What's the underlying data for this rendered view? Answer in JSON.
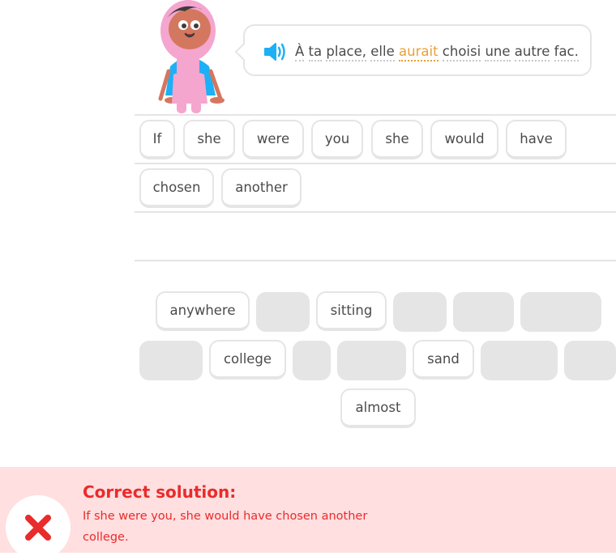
{
  "prompt": {
    "words": [
      {
        "text": "À",
        "highlight": false
      },
      {
        "text": "ta",
        "highlight": false
      },
      {
        "text": "place,",
        "highlight": false
      },
      {
        "text": "elle",
        "highlight": false
      },
      {
        "text": "aurait",
        "highlight": true
      },
      {
        "text": "choisi",
        "highlight": false
      },
      {
        "text": "une",
        "highlight": false
      },
      {
        "text": "autre",
        "highlight": false
      },
      {
        "text": "fac.",
        "highlight": false
      }
    ]
  },
  "answer_tiles": [
    "If",
    "she",
    "were",
    "you",
    "she",
    "would",
    "have",
    "chosen",
    "another"
  ],
  "word_bank": {
    "row1": [
      "anywhere",
      "",
      "sitting",
      "",
      "",
      ""
    ],
    "row2": [
      "",
      "college",
      "",
      "",
      "sand",
      "",
      ""
    ],
    "row3": [
      "almost"
    ]
  },
  "feedback": {
    "title": "Correct solution:",
    "solution": "If she were you, she would have chosen another college."
  },
  "colors": {
    "highlight": "#e8a135",
    "speaker": "#1cb0f6",
    "error": "#ea2b2b",
    "error_bg": "#ffdfe0",
    "tile_border": "#e5e5e5"
  },
  "icons": {
    "speaker": "speaker-icon",
    "feedback": "close-x-icon",
    "character": "character-illustration"
  }
}
